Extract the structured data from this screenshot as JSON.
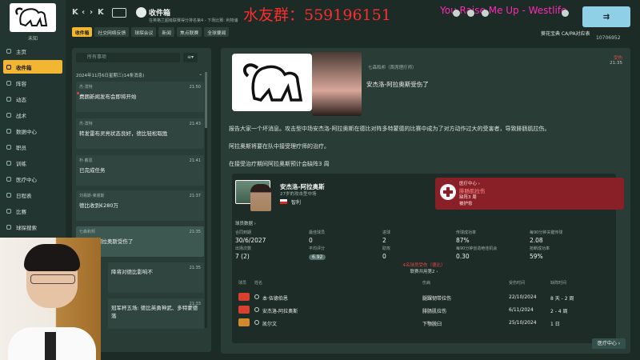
{
  "sidebar": {
    "club_name": "未知",
    "items": [
      {
        "label": "主页",
        "active": false
      },
      {
        "label": "收件箱",
        "active": true
      },
      {
        "label": "阵容",
        "active": false
      },
      {
        "label": "动态",
        "active": false
      },
      {
        "label": "战术",
        "active": false
      },
      {
        "label": "数据中心",
        "active": false
      },
      {
        "label": "职员",
        "active": false
      },
      {
        "label": "训练",
        "active": false
      },
      {
        "label": "医疗中心",
        "active": false
      },
      {
        "label": "日程表",
        "active": false
      },
      {
        "label": "比赛",
        "active": false
      },
      {
        "label": "球探搜索",
        "active": false
      }
    ]
  },
  "header": {
    "title": "收件箱",
    "subtitle": "在英格兰超级联赛得分排名第4 - 下场比赛: 利物浦",
    "tabs": [
      "收件箱",
      "社交网络反馈",
      "球探会议",
      "新闻",
      "焦点联赛",
      "全球要闻"
    ],
    "manager_label": "葵花宝典 CA/PA对应表",
    "manager_id": "10706952"
  },
  "overlay": {
    "qq_group": "水友群：559196151",
    "song": "You Raise Me Up - Westlife"
  },
  "inbox": {
    "search_placeholder": "所有事项",
    "filter_label": "≡▾",
    "date_group": "2024年11月6日星期三(14条消息)",
    "messages": [
      {
        "from": "杰·泼特",
        "subject": "费朗新闻发布会即将开始",
        "time": "21:50",
        "unread": true,
        "selected": false
      },
      {
        "from": "杰·泼特",
        "subject": "转发雷布灵亮状态良好，德比轻松取胜",
        "time": "21:43",
        "unread": false,
        "selected": false
      },
      {
        "from": "朴·戴恩",
        "subject": "已完成任务",
        "time": "21:41",
        "unread": false,
        "selected": false
      },
      {
        "from": "刘易斯·莱谢斯",
        "subject": "德比收到€280万",
        "time": "21:37",
        "unread": false,
        "selected": false
      },
      {
        "from": "七森和邦",
        "subject": "安杰洛-阿拉奥斯受伤了",
        "time": "21:35",
        "unread": false,
        "selected": true
      },
      {
        "from": "",
        "subject": "降将对德比影响不",
        "time": "21:35",
        "unread": false,
        "selected": false
      },
      {
        "from": "",
        "subject": "冠军杯五场: 德比英勇神武、多特蒙德落",
        "time": "21:33",
        "unread": false,
        "selected": false
      }
    ]
  },
  "detail": {
    "sender_role": "七森和邦（首席理疗师）",
    "title": "安杰洛-阿拉奥斯受伤了",
    "flag_label": "受伤",
    "time": "21:35",
    "paragraphs": [
      "报告大家一个坏消息。攻击型中场安杰洛-阿拉奥斯在德比对阵多特蒙德的比赛中成为了对方动作过大的受害者，导致腓肠肌拉伤。",
      "阿拉奥斯将要在队中接受理疗师的治疗。",
      "在接受治疗期间阿拉奥斯预计会缺阵3 周"
    ],
    "player": {
      "name": "安杰洛-阿拉奥斯",
      "info": "27岁的攻击型中场",
      "nation": "智利"
    },
    "medical": {
      "title": "医疗中心 ›",
      "injury": "腓肠肌拉伤",
      "out": "缺阵3 周",
      "status": "被护愈"
    },
    "stats_header": "球员数据 ›",
    "stats": [
      {
        "label": "合同到期",
        "value": "30/6/2027"
      },
      {
        "label": "最佳球员",
        "value": "0"
      },
      {
        "label": "进球",
        "value": "2"
      },
      {
        "label": "传球成功率",
        "value": "87%"
      },
      {
        "label": "每90分钟关键传球",
        "value": "2.08"
      },
      {
        "label": "出场次数",
        "value": "7 (2)"
      },
      {
        "label": "平均评分",
        "value": "6.92"
      },
      {
        "label": "助攻",
        "value": "0"
      },
      {
        "label": "每90分钟创造绝佳机会",
        "value": "0.30"
      },
      {
        "label": "抢断成功率",
        "value": "59%"
      }
    ],
    "injury_list_head": "4名球员受伤（德比）",
    "injury_list_sub": "联赛共用第2 ›",
    "injury_cols": [
      "球员",
      "姓名",
      "",
      "伤病",
      "受伤时间",
      "缺阵时间"
    ],
    "injuries": [
      {
        "name": "本·伍德伯恩",
        "injury": "腿踝韧带拉伤",
        "date": "22/10/2024",
        "duration": "8 天 - 2 周"
      },
      {
        "name": "安杰洛-阿拉奥斯",
        "injury": "腓肠肌拉伤",
        "date": "6/11/2024",
        "duration": "2 - 4 周"
      },
      {
        "name": "凯尔文",
        "injury": "下颚脱臼",
        "date": "25/10/2024",
        "duration": "1 日"
      }
    ],
    "medical_button": "医疗中心 ›"
  },
  "colors": {
    "accent": "#f2b632",
    "background": "#1c2b26",
    "panel": "#2a3c36",
    "injury_red": "#8a2027"
  }
}
